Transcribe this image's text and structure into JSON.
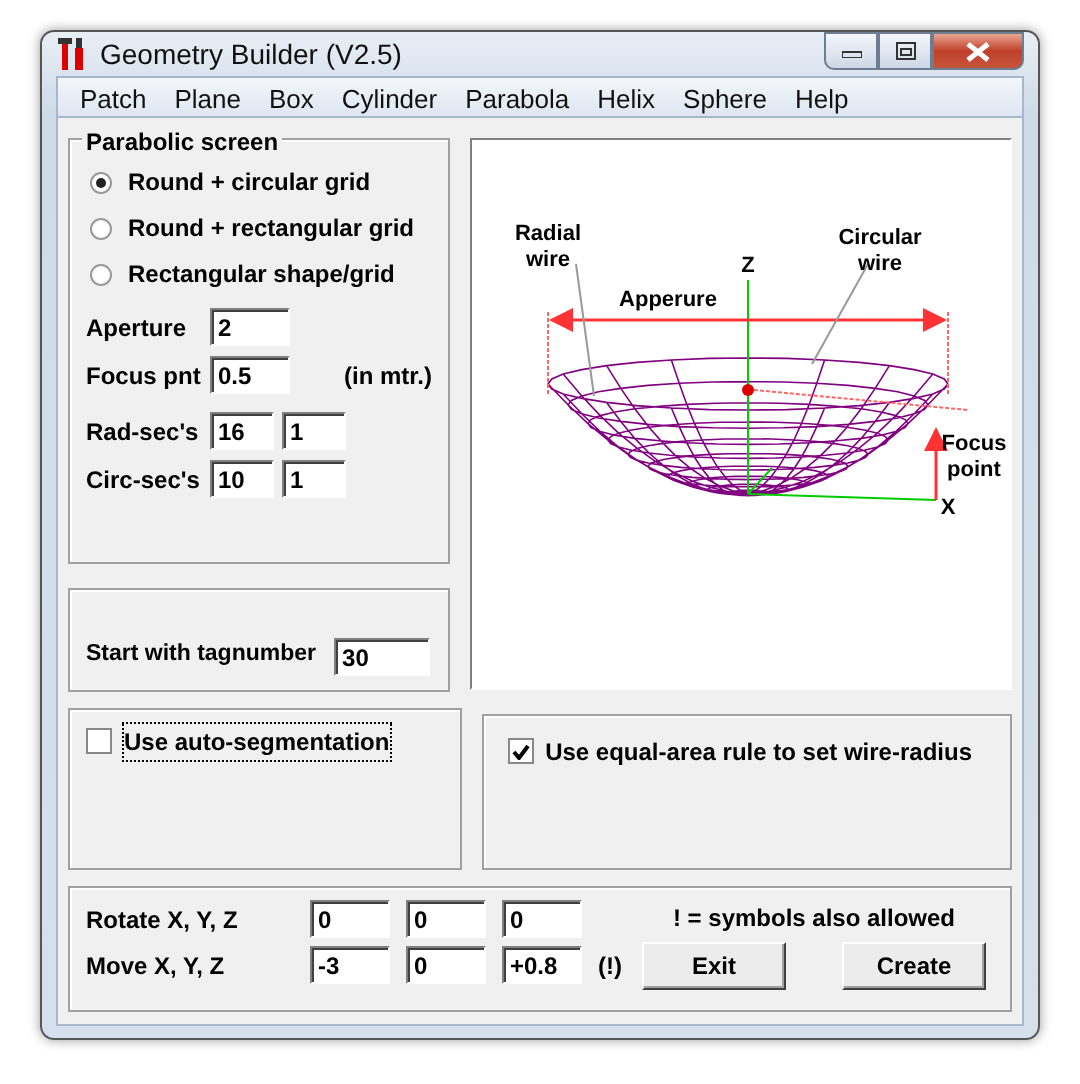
{
  "window": {
    "title": "Geometry Builder (V2.5)"
  },
  "menu": [
    "Patch",
    "Plane",
    "Box",
    "Cylinder",
    "Parabola",
    "Helix",
    "Sphere",
    "Help"
  ],
  "parabolic_screen": {
    "title": "Parabolic screen",
    "options": [
      {
        "label": "Round + circular grid",
        "selected": true
      },
      {
        "label": "Round + rectangular grid",
        "selected": false
      },
      {
        "label": "Rectangular shape/grid",
        "selected": false
      }
    ],
    "aperture": {
      "label": "Aperture",
      "value": "2"
    },
    "focus": {
      "label": "Focus pnt",
      "value": "0.5",
      "unit": "(in mtr.)"
    },
    "rad_secs": {
      "label": "Rad-sec's",
      "values": [
        "16",
        "1"
      ]
    },
    "circ_secs": {
      "label": "Circ-sec's",
      "values": [
        "10",
        "1"
      ]
    }
  },
  "diagram": {
    "radial_wire": [
      "Radial",
      "wire"
    ],
    "circular_wire": [
      "Circular",
      "wire"
    ],
    "aperture": "Apperure",
    "z_axis": "Z",
    "x_axis": "X",
    "focus_point": [
      "Focus",
      "point"
    ]
  },
  "tagnumber": {
    "label": "Start with tagnumber",
    "value": "30"
  },
  "auto_segmentation": {
    "label": "Use auto-segmentation",
    "checked": false
  },
  "equal_area": {
    "label": "Use equal-area rule to set wire-radius",
    "checked": true
  },
  "transform": {
    "note": "! =  symbols also allowed",
    "rotate": {
      "label": "Rotate X, Y, Z",
      "values": [
        "0",
        "0",
        "0"
      ]
    },
    "move": {
      "label": "Move X, Y, Z",
      "values": [
        "-3",
        "0",
        "+0.8"
      ],
      "suffix": "(!)"
    }
  },
  "buttons": [
    "Exit",
    "Create"
  ]
}
